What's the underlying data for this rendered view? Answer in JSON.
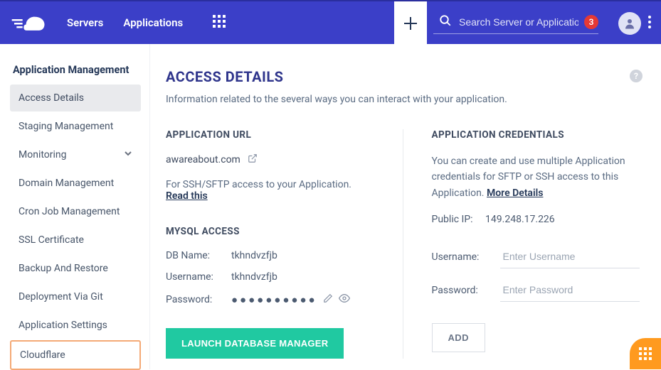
{
  "nav": {
    "servers": "Servers",
    "applications": "Applications"
  },
  "search": {
    "placeholder": "Search Server or Application",
    "badge": "3"
  },
  "sidebar": {
    "title": "Application Management",
    "items": [
      {
        "label": "Access Details"
      },
      {
        "label": "Staging Management"
      },
      {
        "label": "Monitoring"
      },
      {
        "label": "Domain Management"
      },
      {
        "label": "Cron Job Management"
      },
      {
        "label": "SSL Certificate"
      },
      {
        "label": "Backup And Restore"
      },
      {
        "label": "Deployment Via Git"
      },
      {
        "label": "Application Settings"
      },
      {
        "label": "Cloudflare"
      }
    ]
  },
  "page": {
    "title": "ACCESS DETAILS",
    "subtitle": "Information related to the several ways you can interact with your application."
  },
  "app_url": {
    "heading": "APPLICATION URL",
    "url": "awareabout.com",
    "hint_prefix": "For SSH/SFTP access to your Application. ",
    "hint_link": "Read this"
  },
  "mysql": {
    "heading": "MYSQL ACCESS",
    "dbname_label": "DB Name:",
    "dbname_value": "tkhndvzfjb",
    "username_label": "Username:",
    "username_value": "tkhndvzfjb",
    "password_label": "Password:",
    "password_masked": "●●●●●●●●●●",
    "launch_label": "LAUNCH DATABASE MANAGER"
  },
  "creds": {
    "heading": "APPLICATION CREDENTIALS",
    "desc_prefix": "You can create and use multiple Application credentials for SFTP or SSH access to this Application. ",
    "desc_link": "More Details",
    "ip_label": "Public IP:",
    "ip_value": "149.248.17.226",
    "username_label": "Username:",
    "username_placeholder": "Enter Username",
    "password_label": "Password:",
    "password_placeholder": "Enter Password",
    "add_label": "ADD"
  }
}
